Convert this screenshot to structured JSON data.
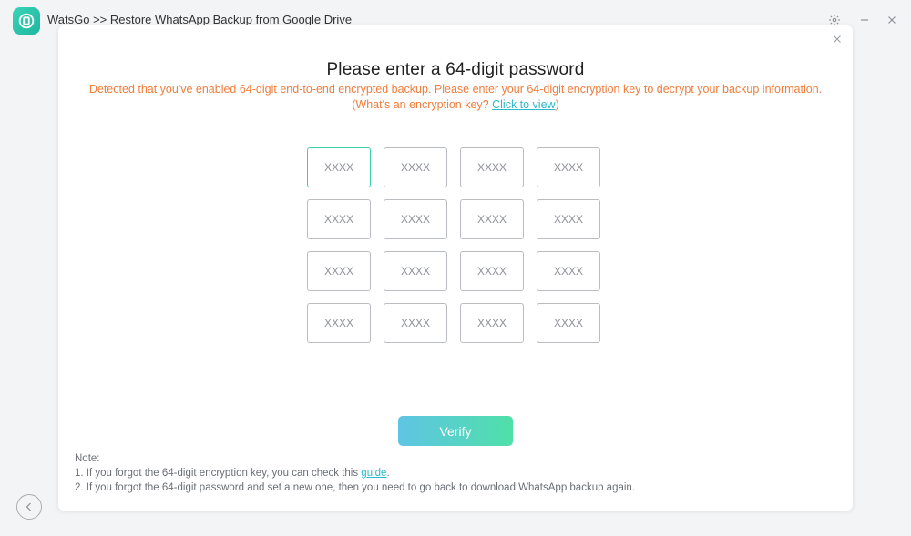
{
  "window": {
    "title": "WatsGo >> Restore WhatsApp Backup from Google Drive",
    "controls": [
      "settings-icon",
      "minimize-icon",
      "close-icon"
    ]
  },
  "dialog": {
    "title": "Please enter a 64-digit password",
    "warning": "Detected that you've enabled 64-digit end-to-end encrypted backup. Please enter your 64-digit encryption key to decrypt your backup information.",
    "question_prefix": "(What's an encryption key? ",
    "question_link": "Click to view",
    "question_suffix": ")",
    "key_placeholder": "XXXX",
    "key_fields": [
      "",
      "",
      "",
      "",
      "",
      "",
      "",
      "",
      "",
      "",
      "",
      "",
      "",
      "",
      "",
      ""
    ],
    "verify_label": "Verify",
    "notes": {
      "heading": "Note:",
      "line1_prefix": "1. If you forgot the 64-digit encryption key, you can check this ",
      "line1_link": "guide",
      "line1_suffix": ".",
      "line2": "2. If you forgot the 64-digit password and set a new one, then you need to go back to download WhatsApp backup again."
    }
  },
  "colors": {
    "accent_teal": "#3ecfb0",
    "warning_orange": "#f07d3c",
    "link": "#2fb8c9",
    "button_gradient_start": "#5fc4e4",
    "button_gradient_end": "#4fe0a8"
  }
}
